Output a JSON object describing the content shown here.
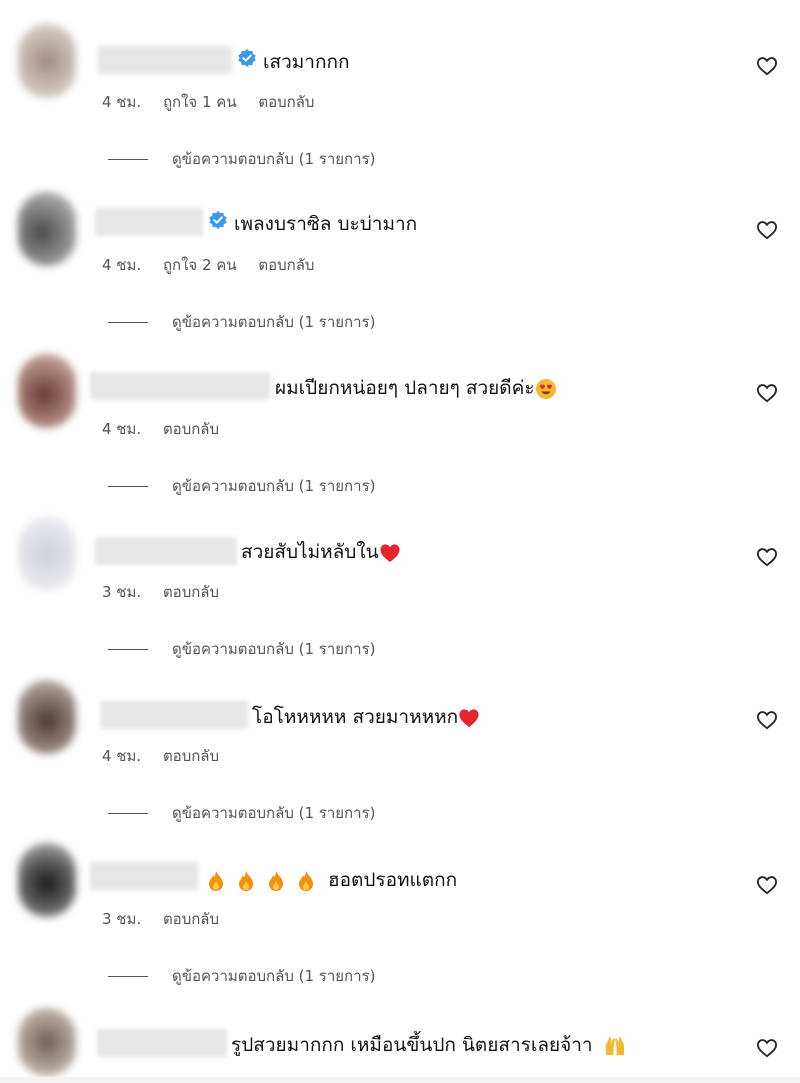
{
  "comments": [
    {
      "text": "เสวมากกก",
      "time": "4 ชม.",
      "likes": "ถูกใจ 1 คน",
      "reply": "ตอบกลับ",
      "view_replies": "ดูข้อความตอบกลับ (1 รายการ)",
      "verified": true,
      "emoji": []
    },
    {
      "text": "เพลงบราซิล บะบ่ามาก",
      "time": "4 ชม.",
      "likes": "ถูกใจ 2 คน",
      "reply": "ตอบกลับ",
      "view_replies": "ดูข้อความตอบกลับ (1 รายการ)",
      "verified": true,
      "emoji": []
    },
    {
      "text": "ผมเปียกหน่อยๆ ปลายๆ สวยดีค่ะ",
      "time": "4 ชม.",
      "likes": "",
      "reply": "ตอบกลับ",
      "view_replies": "ดูข้อความตอบกลับ (1 รายการ)",
      "verified": false,
      "emoji": [
        "heart-eyes-emoji"
      ]
    },
    {
      "text": "สวยสับไม่หลับใน",
      "time": "3 ชม.",
      "likes": "",
      "reply": "ตอบกลับ",
      "view_replies": "ดูข้อความตอบกลับ (1 รายการ)",
      "verified": false,
      "emoji": [
        "red-heart-emoji"
      ]
    },
    {
      "text": "โอโหหหหห สวยมาหหหก",
      "time": "4 ชม.",
      "likes": "",
      "reply": "ตอบกลับ",
      "view_replies": "ดูข้อความตอบกลับ (1 รายการ)",
      "verified": false,
      "emoji": [
        "red-heart-emoji"
      ]
    },
    {
      "text": "ฮอตปรอทแตกก",
      "time": "3 ชม.",
      "likes": "",
      "reply": "ตอบกลับ",
      "view_replies": "ดูข้อความตอบกลับ (1 รายการ)",
      "verified": false,
      "emoji": [
        "fire-emoji",
        "fire-emoji",
        "fire-emoji",
        "fire-emoji"
      ]
    },
    {
      "text": "รูปสวยมากกก เหมือนขึ้นปก นิตยสารเลยจ้าา",
      "time": "",
      "likes": "",
      "reply": "",
      "view_replies": "",
      "verified": false,
      "emoji": [
        "raising-hands-emoji"
      ]
    }
  ],
  "colors": {
    "verified_blue": "#3897f0",
    "meta_gray": "#555555",
    "heart_outline": "#262626",
    "fire_orange": "#f4900c",
    "red_heart": "#e8242f"
  }
}
